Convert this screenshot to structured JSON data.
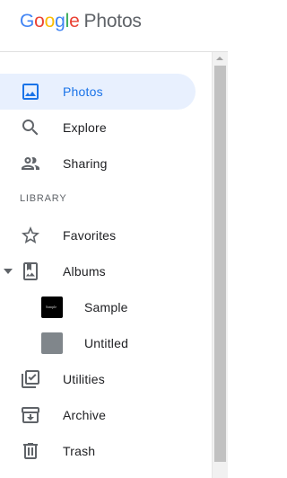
{
  "brand": {
    "logo_letters": [
      "G",
      "o",
      "o",
      "g",
      "l",
      "e"
    ],
    "product": "Photos",
    "logo_colors": [
      "#4285f4",
      "#ea4335",
      "#fbbc05",
      "#4285f4",
      "#34a853",
      "#ea4335"
    ]
  },
  "nav": {
    "items": [
      {
        "label": "Photos",
        "icon": "photo-icon",
        "active": true
      },
      {
        "label": "Explore",
        "icon": "search-icon"
      },
      {
        "label": "Sharing",
        "icon": "people-icon"
      }
    ],
    "library_header": "LIBRARY",
    "library_items": [
      {
        "label": "Favorites",
        "icon": "star-icon"
      },
      {
        "label": "Albums",
        "icon": "album-icon",
        "expanded": true
      }
    ],
    "albums": [
      {
        "label": "Sample",
        "thumb": "dark",
        "thumb_text": "Sample"
      },
      {
        "label": "Untitled",
        "thumb": "grey"
      }
    ],
    "bottom_items": [
      {
        "label": "Utilities",
        "icon": "utilities-icon"
      },
      {
        "label": "Archive",
        "icon": "archive-icon"
      },
      {
        "label": "Trash",
        "icon": "trash-icon"
      }
    ]
  },
  "colors": {
    "active_bg": "#e8f0fe",
    "active_text": "#1a73e8",
    "icon_grey": "#5f6368"
  }
}
